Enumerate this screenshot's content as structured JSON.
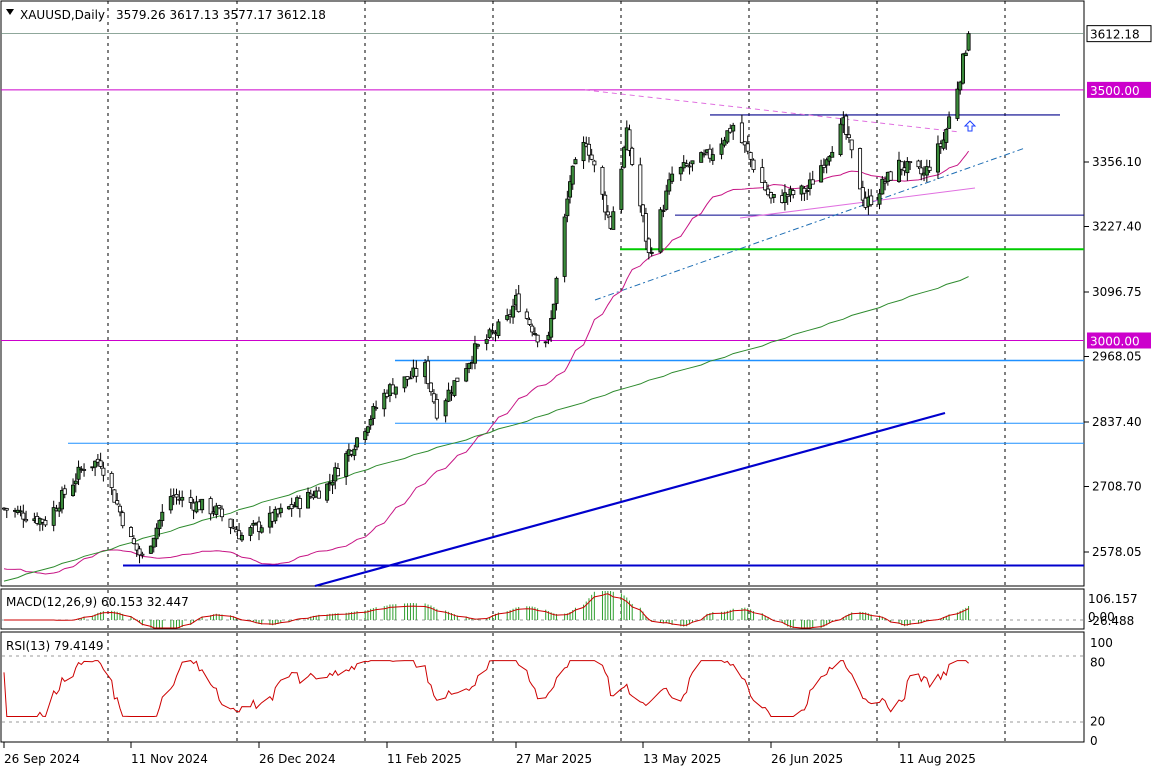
{
  "header": {
    "symbol": "XAUUSD,Daily",
    "ohlc": "3579.26 3617.13 3577.17 3612.18"
  },
  "chart_data": {
    "type": "candlestick",
    "symbol": "XAUUSD",
    "timeframe": "Daily",
    "last": {
      "open": 3579.26,
      "high": 3617.13,
      "low": 3577.17,
      "close": 3612.18
    },
    "price_axis_ticks": [
      "3356.10",
      "3227.40",
      "3096.75",
      "2968.05",
      "2837.40",
      "2708.70",
      "2578.05"
    ],
    "price_ylim": [
      2510,
      3660
    ],
    "date_labels": [
      "26 Sep 2024",
      "11 Nov 2024",
      "26 Dec 2024",
      "11 Feb 2025",
      "27 Mar 2025",
      "13 May 2025",
      "26 Jun 2025",
      "11 Aug 2025"
    ],
    "current_price_label": "3612.18",
    "levels": [
      {
        "price": 3500.0,
        "label": "3500.00",
        "color": "#cc00cc"
      },
      {
        "price": 3000.0,
        "label": "3000.00",
        "color": "#cc00cc"
      },
      {
        "price": 3450,
        "label": "",
        "color": "#00008b"
      },
      {
        "price": 3250,
        "label": "",
        "color": "#00008b"
      },
      {
        "price": 3182,
        "label": "",
        "color": "#00cc00"
      },
      {
        "price": 2960,
        "label": "",
        "color": "#1e90ff"
      },
      {
        "price": 2835,
        "label": "",
        "color": "#1e90ff"
      },
      {
        "price": 2795,
        "label": "",
        "color": "#1e90ff"
      },
      {
        "price": 2551,
        "label": "",
        "color": "#0000cd"
      }
    ],
    "trend_anchors": [
      {
        "date": "26 Sep 2024",
        "price": 2665
      },
      {
        "date": "11 Oct 2024",
        "price": 2640
      },
      {
        "date": "25 Oct 2024",
        "price": 2750
      },
      {
        "date": "31 Oct 2024",
        "price": 2760
      },
      {
        "date": "11 Nov 2024",
        "price": 2600
      },
      {
        "date": "15 Nov 2024",
        "price": 2565
      },
      {
        "date": "25 Nov 2024",
        "price": 2690
      },
      {
        "date": "11 Dec 2024",
        "price": 2660
      },
      {
        "date": "20 Dec 2024",
        "price": 2610
      },
      {
        "date": "26 Dec 2024",
        "price": 2630
      },
      {
        "date": "20 Jan 2025",
        "price": 2710
      },
      {
        "date": "11 Feb 2025",
        "price": 2900
      },
      {
        "date": "24 Feb 2025",
        "price": 2945
      },
      {
        "date": "28 Feb 2025",
        "price": 2860
      },
      {
        "date": "13 Mar 2025",
        "price": 2980
      },
      {
        "date": "24 Mar 2025",
        "price": 3040
      },
      {
        "date": "27 Mar 2025",
        "price": 3080
      },
      {
        "date": "04 Apr 2025",
        "price": 3010
      },
      {
        "date": "08 Apr 2025",
        "price": 3000
      },
      {
        "date": "16 Apr 2025",
        "price": 3320
      },
      {
        "date": "22 Apr 2025",
        "price": 3400
      },
      {
        "date": "01 May 2025",
        "price": 3230
      },
      {
        "date": "07 May 2025",
        "price": 3410
      },
      {
        "date": "15 May 2025",
        "price": 3170
      },
      {
        "date": "13 May 2025",
        "price": 3240
      },
      {
        "date": "23 May 2025",
        "price": 3330
      },
      {
        "date": "05 Jun 2025",
        "price": 3370
      },
      {
        "date": "13 Jun 2025",
        "price": 3430
      },
      {
        "date": "26 Jun 2025",
        "price": 3280
      },
      {
        "date": "09 Jul 2025",
        "price": 3300
      },
      {
        "date": "22 Jul 2025",
        "price": 3430
      },
      {
        "date": "30 Jul 2025",
        "price": 3270
      },
      {
        "date": "11 Aug 2025",
        "price": 3350
      },
      {
        "date": "20 Aug 2025",
        "price": 3330
      },
      {
        "date": "27 Aug 2025",
        "price": 3400
      },
      {
        "date": "02 Sep 2025",
        "price": 3530
      },
      {
        "date": "05 Sep 2025",
        "price": 3612
      }
    ],
    "indicators": {
      "macd": {
        "label": "MACD(12,26,9) 60.153 32.447",
        "ticks": [
          "106.157",
          "0.00",
          "-26.488"
        ]
      },
      "rsi": {
        "label": "RSI(13) 79.4149",
        "ticks": [
          "100",
          "80",
          "20",
          "0"
        ],
        "value": 79.4149
      }
    }
  }
}
